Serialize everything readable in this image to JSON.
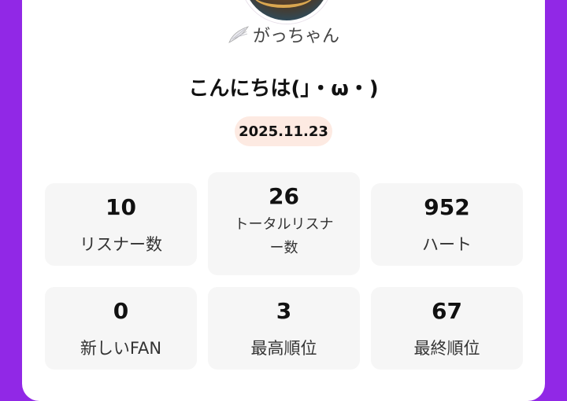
{
  "profile": {
    "name": "がっちゃん",
    "greeting": "こんにちは(」・ω・)",
    "date": "2025.11.23"
  },
  "stats": [
    {
      "value": "10",
      "label": "リスナー数"
    },
    {
      "value": "26",
      "label_line1": "トータルリスナ",
      "label_line2": "ー数"
    },
    {
      "value": "952",
      "label": "ハート"
    },
    {
      "value": "0",
      "label": "新しいFAN"
    },
    {
      "value": "3",
      "label": "最高順位"
    },
    {
      "value": "67",
      "label": "最終順位"
    }
  ],
  "colors": {
    "background": "#9128e6",
    "card": "#ffffff",
    "date_pill": "#fdeae2",
    "stat_tile": "#f6f6f6"
  },
  "icons": {
    "wing": "wing-icon"
  }
}
